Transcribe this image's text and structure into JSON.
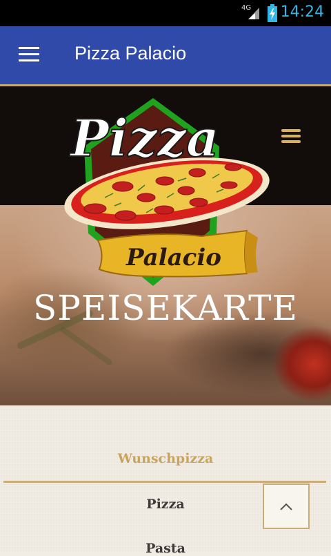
{
  "status_bar": {
    "network": "4G",
    "time": "14:24"
  },
  "app_bar": {
    "title": "Pizza Palacio"
  },
  "logo": {
    "word_top": "Pizza",
    "word_bottom": "Palacio"
  },
  "hero": {
    "heading": "SPEISEKARTE"
  },
  "menu": {
    "items": [
      {
        "label": "Wunschpizza",
        "active": true
      },
      {
        "label": "Pizza",
        "active": false
      },
      {
        "label": "Pasta",
        "active": false
      }
    ]
  },
  "colors": {
    "app_bar": "#2f4aa9",
    "accent_gold": "#c9a45e",
    "status_clock": "#33b5e5",
    "header_dark": "#120d0a"
  },
  "icons": {
    "app_menu": "hamburger-icon",
    "site_menu": "hamburger-icon",
    "scroll_top": "chevron-up-icon"
  }
}
